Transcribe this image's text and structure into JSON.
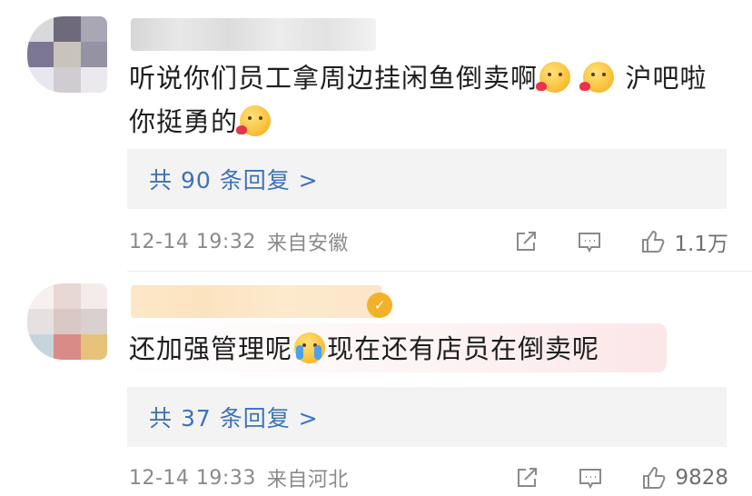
{
  "comments": [
    {
      "text_before": "听说你们员工拿周边挂闲鱼倒卖啊",
      "text_between": " ",
      "text_after": " 沪吧啦你挺勇的",
      "replies": "共 90 条回复 >",
      "timestamp": "12-14 19:32",
      "location": "来自安徽",
      "likes": "1.1万",
      "emojis": [
        "kiss-heart-emoji",
        "kiss-heart-emoji",
        "kiss-heart-emoji"
      ]
    },
    {
      "text_before": "还加强管理呢",
      "text_after": "现在还有店员在倒卖呢",
      "replies": "共 37 条回复 >",
      "timestamp": "12-14 19:33",
      "location": "来自河北",
      "likes": "9828",
      "emojis": [
        "crying-emoji"
      ]
    }
  ],
  "colors": {
    "reply_link": "#3d72b8",
    "meta_text": "#8a8a8a",
    "reply_box_bg": "#f3f3f3"
  }
}
